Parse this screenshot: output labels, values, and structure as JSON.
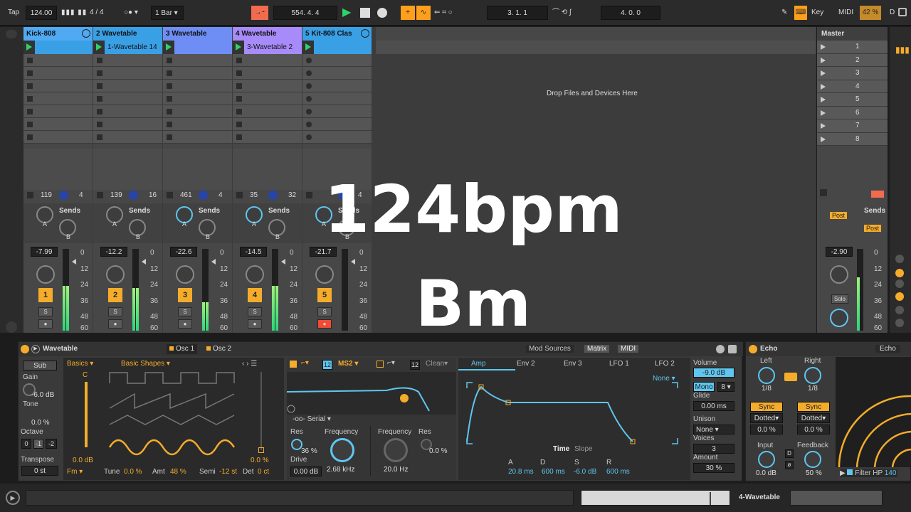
{
  "transport": {
    "tap_label": "Tap",
    "tempo": "124.00",
    "time_sig": "4 / 4",
    "quantize": "1 Bar",
    "position": "554.  4.  4",
    "loop_start": "3.  1.  1",
    "loop_length": "4.  0.  0",
    "key_label": "Key",
    "midi_label": "MIDI",
    "cpu": "42 %",
    "d_label": "D"
  },
  "tracks": [
    {
      "name": "Kick-808",
      "color": "#4fa9f3",
      "clip": "",
      "clip_color": "#3aa0e6",
      "vol": "-7.99",
      "num": "1",
      "io_a": "119",
      "io_b": "4",
      "meter": 0.55
    },
    {
      "name": "2 Wavetable",
      "color": "#3aa0e6",
      "clip": "1-Wavetable 14",
      "clip_color": "#3aa0e6",
      "vol": "-12.2",
      "num": "2",
      "io_a": "139",
      "io_b": "16",
      "meter": 0.52
    },
    {
      "name": "3 Wavetable",
      "color": "#6e8ef5",
      "clip": "",
      "clip_color": "#6e8ef5",
      "vol": "-22.6",
      "num": "3",
      "io_a": "461",
      "io_b": "4",
      "meter": 0.35
    },
    {
      "name": "4 Wavetable",
      "color": "#a78bfa",
      "clip": "3-Wavetable 2",
      "clip_color": "#a78bfa",
      "vol": "-14.5",
      "num": "4",
      "io_a": "35",
      "io_b": "32",
      "meter": 0.55
    },
    {
      "name": "5 Kit-808 Clas",
      "color": "#3aa0e6",
      "clip": "",
      "clip_color": "#3aa0e6",
      "vol": "-21.7",
      "num": "5",
      "io_a": "",
      "io_b": "4",
      "meter": 0.0
    }
  ],
  "sends_label": "Sends",
  "send_a": "A",
  "send_b": "B",
  "s_label": "S",
  "db_scale": [
    "0",
    "12",
    "24",
    "36",
    "48",
    "60"
  ],
  "drop_text": "Drop Files and Devices Here",
  "master": {
    "title": "Master",
    "scenes": [
      "1",
      "2",
      "3",
      "4",
      "5",
      "6",
      "7",
      "8"
    ],
    "sends_label": "Sends",
    "post_label": "Post",
    "vol": "-2.90",
    "solo_label": "Solo"
  },
  "overlay": {
    "bpm": "124bpm",
    "key": "Bm"
  },
  "wavetable": {
    "title": "Wavetable",
    "osc1": "Osc 1",
    "osc2": "Osc 2",
    "sub": "Sub",
    "gain_label": "Gain",
    "gain": "-6.0 dB",
    "tone_label": "Tone",
    "tone": "0.0 %",
    "octave_label": "Octave",
    "octaves": [
      "0",
      "-1",
      "-2"
    ],
    "transpose_label": "Transpose",
    "transpose": "0 st",
    "category": "Basics",
    "wavetable": "Basic Shapes",
    "osc_gain": "0.0 dB",
    "osc_pct": "0.0 %",
    "fm": "Fm",
    "tune_label": "Tune",
    "tune": "0.0 %",
    "amt_label": "Amt",
    "amt": "48 %",
    "semi_label": "Semi",
    "semi": "-12 st",
    "det_label": "Det",
    "det": "0 ct",
    "c_label": "C",
    "filter_slope": "12",
    "filter_type": "MS2",
    "filter2_slope": "12",
    "filter2_type": "Clean",
    "serial": "Serial",
    "res_label": "Res",
    "res": "36 %",
    "freq_label": "Frequency",
    "freq": "2.68 kHz",
    "drive_label": "Drive",
    "drive": "0.00 dB",
    "freq2_label": "Frequency",
    "freq2": "20.0 Hz",
    "res2_label": "Res",
    "res2": "0.0 %",
    "mod_sources": "Mod Sources",
    "matrix": "Matrix",
    "midi": "MIDI",
    "env_tabs": [
      "Amp",
      "Env 2",
      "Env 3",
      "LFO 1",
      "LFO 2"
    ],
    "none_label": "None",
    "time_label": "Time",
    "slope_label": "Slope",
    "adsr_labels": [
      "A",
      "D",
      "S",
      "R"
    ],
    "adsr_values": [
      "20.8 ms",
      "600 ms",
      "-6.0 dB",
      "600 ms"
    ],
    "volume_label": "Volume",
    "volume": "-9.0 dB",
    "mono_label": "Mono",
    "mono_voices": "8",
    "glide_label": "Glide",
    "glide": "0.00 ms",
    "unison_label": "Unison",
    "unison": "None",
    "voices_label": "Voices",
    "voices": "3",
    "amount_label": "Amount",
    "amount": "30 %"
  },
  "echo": {
    "title": "Echo",
    "tab": "Echo",
    "left_label": "Left",
    "right_label": "Right",
    "left_val": "1/8",
    "right_val": "1/8",
    "sync": "Sync",
    "dotted": "Dotted",
    "left_pct": "0.0 %",
    "right_pct": "0.0 %",
    "input_label": "Input",
    "input": "0.0 dB",
    "feedback_label": "Feedback",
    "feedback": "50 %",
    "d_btn": "D",
    "filter_label": "Filter HP",
    "filter_val": "140"
  },
  "status": {
    "track_name": "4-Wavetable"
  }
}
